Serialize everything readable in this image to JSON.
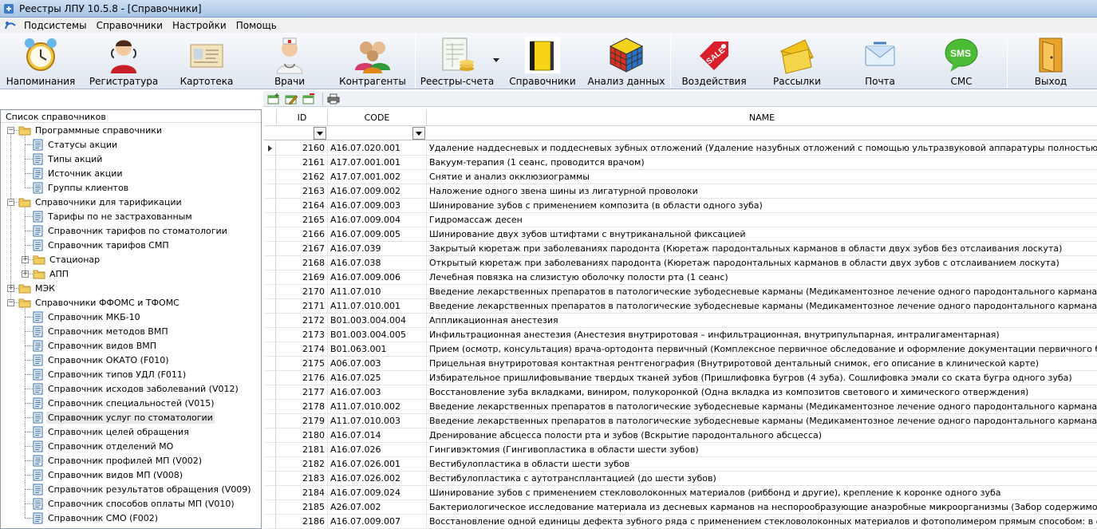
{
  "window": {
    "title": "Реестры ЛПУ 10.5.8 - [Справочники]"
  },
  "menu": [
    "Подсистемы",
    "Справочники",
    "Настройки",
    "Помощь"
  ],
  "toolbar": [
    {
      "label": "Напоминания",
      "icon": "alarm-clock-icon"
    },
    {
      "label": "Регистратура",
      "icon": "receptionist-icon"
    },
    {
      "label": "Картотека",
      "icon": "card-file-icon"
    },
    {
      "label": "Врачи",
      "icon": "doctor-icon"
    },
    {
      "label": "Контрагенты",
      "icon": "people-icon"
    },
    {
      "label": "Реестры-счета",
      "icon": "invoice-registry-icon"
    },
    {
      "label": "Справочники",
      "icon": "books-icon"
    },
    {
      "label": "Анализ данных",
      "icon": "rubik-cube-icon"
    },
    {
      "label": "Воздействия",
      "icon": "sale-tag-icon"
    },
    {
      "label": "Рассылки",
      "icon": "envelope-icon"
    },
    {
      "label": "Почта",
      "icon": "mail-icon"
    },
    {
      "label": "СМС",
      "icon": "sms-bubble-icon"
    },
    {
      "label": "Выход",
      "icon": "exit-door-icon"
    }
  ],
  "left_panel": {
    "title": "Список справочников",
    "tree": [
      {
        "label": "Программные справочники",
        "level": 0,
        "type": "folder",
        "expanded": true
      },
      {
        "label": "Статусы акции",
        "level": 1,
        "type": "doc"
      },
      {
        "label": "Типы акций",
        "level": 1,
        "type": "doc"
      },
      {
        "label": "Источник акции",
        "level": 1,
        "type": "doc"
      },
      {
        "label": "Группы клиентов",
        "level": 1,
        "type": "doc"
      },
      {
        "label": "Справочники для тарификации",
        "level": 0,
        "type": "folder",
        "expanded": true
      },
      {
        "label": "Тарифы по не застрахованным",
        "level": 1,
        "type": "doc"
      },
      {
        "label": "Справочник тарифов по стоматологии",
        "level": 1,
        "type": "doc"
      },
      {
        "label": "Справочник тарифов СМП",
        "level": 1,
        "type": "doc"
      },
      {
        "label": "Стационар",
        "level": 1,
        "type": "folder",
        "expanded": false
      },
      {
        "label": "АПП",
        "level": 1,
        "type": "folder",
        "expanded": false
      },
      {
        "label": "МЭК",
        "level": 0,
        "type": "folder",
        "expanded": false
      },
      {
        "label": "Справочники ФФОМС и ТФОМС",
        "level": 0,
        "type": "folder",
        "expanded": true
      },
      {
        "label": "Справочник МКБ-10",
        "level": 1,
        "type": "doc"
      },
      {
        "label": "Справочник методов ВМП",
        "level": 1,
        "type": "doc"
      },
      {
        "label": "Справочник видов ВМП",
        "level": 1,
        "type": "doc"
      },
      {
        "label": "Справочник ОКАТО (F010)",
        "level": 1,
        "type": "doc"
      },
      {
        "label": "Справочник типов УДЛ (F011)",
        "level": 1,
        "type": "doc"
      },
      {
        "label": "Справочник исходов заболеваний (V012)",
        "level": 1,
        "type": "doc"
      },
      {
        "label": "Справочник специальностей (V015)",
        "level": 1,
        "type": "doc"
      },
      {
        "label": "Справочник услуг по стоматологии",
        "level": 1,
        "type": "doc",
        "selected": true
      },
      {
        "label": "Справочник целей обращения",
        "level": 1,
        "type": "doc"
      },
      {
        "label": "Справочник отделений МО",
        "level": 1,
        "type": "doc"
      },
      {
        "label": "Справочник профилей МП (V002)",
        "level": 1,
        "type": "doc"
      },
      {
        "label": "Справочник видов МП (V008)",
        "level": 1,
        "type": "doc"
      },
      {
        "label": "Справочник результатов обращения (V009)",
        "level": 1,
        "type": "doc"
      },
      {
        "label": "Справочник способов оплаты МП (V010)",
        "level": 1,
        "type": "doc"
      },
      {
        "label": "Справочник СМО (F002)",
        "level": 1,
        "type": "doc"
      }
    ]
  },
  "grid": {
    "columns": [
      "ID",
      "CODE",
      "NAME"
    ],
    "rows": [
      [
        "2160",
        "A16.07.020.001",
        "Удаление наддесневых и поддесневых зубных отложений (Удаление назубных отложений с помощью ультразвуковой аппаратуры полностью (не менее 5 зубов)"
      ],
      [
        "2161",
        "A17.07.001.001",
        "Вакуум-терапия (1 сеанс, проводится врачом)"
      ],
      [
        "2162",
        "A17.07.001.002",
        "Снятие и анализ окклюзиограммы"
      ],
      [
        "2163",
        "A16.07.009.002",
        "Наложение одного звена шины из лигатурной проволоки"
      ],
      [
        "2164",
        "A16.07.009.003",
        "Шинирование зубов с применением композита (в области одного зуба)"
      ],
      [
        "2165",
        "A16.07.009.004",
        "Гидромассаж десен"
      ],
      [
        "2166",
        "A16.07.009.005",
        "Шинирование двух зубов штифтами с внутриканальной фиксацией"
      ],
      [
        "2167",
        "A16.07.039",
        "Закрытый кюретаж при заболеваниях пародонта (Кюретаж пародонтальных карманов в области двух зубов без отслаивания лоскута)"
      ],
      [
        "2168",
        "A16.07.038",
        "Открытый кюретаж при заболеваниях пародонта (Кюретаж пародонтальных карманов в области двух зубов с отслаиванием лоскута)"
      ],
      [
        "2169",
        "A16.07.009.006",
        "Лечебная повязка на слизистую оболочку полости рта (1 сеанс)"
      ],
      [
        "2170",
        "A11.07.010",
        "Введение лекарственных препаратов в патологические зубодесневые карманы (Медикаментозное лечение одного пародонтального кармана: орошение)"
      ],
      [
        "2171",
        "A11.07.010.001",
        "Введение лекарственных препаратов в патологические зубодесневые карманы (Медикаментозное лечение одного пародонтального кармана: аппликация)"
      ],
      [
        "2172",
        "B01.003.004.004",
        "Аппликационная анестезия"
      ],
      [
        "2173",
        "B01.003.004.005",
        "Инфильтрационная анестезия (Анестезия внутриротовая – инфильтрационная, внутрипульпарная, интралигаментарная)"
      ],
      [
        "2174",
        "B01.063.001",
        "Прием (осмотр, консультация) врача-ортодонта первичный (Комплексное первичное обследование и оформление документации первичного больного (антропометр"
      ],
      [
        "2175",
        "A06.07.003",
        "Прицельная внутриротовая контактная рентгенография (Внутриротовой дентальный снимок, его описание в клинической карте)"
      ],
      [
        "2176",
        "A16.07.025",
        "Избирательное пришлифовывание твердых тканей зубов (Пришлифовка бугров (4 зуба). Сошлифовка эмали со ската бугра одного зуба)"
      ],
      [
        "2177",
        "A16.07.003",
        "Восстановление зуба вкладками, виниром, полукоронкой (Одна вкладка из композитов светового и химического отверждения)"
      ],
      [
        "2178",
        "A11.07.010.002",
        "Введение лекарственных препаратов в патологические зубодесневые карманы (Медикаментозное лечение одного пародонтального кармана: инстилляция)"
      ],
      [
        "2179",
        "A11.07.010.003",
        "Введение лекарственных препаратов в патологические зубодесневые карманы (Медикаментозное лечение одного пародонтального кармана: повязка)"
      ],
      [
        "2180",
        "A16.07.014",
        "Дренирование абсцесса полости рта и зубов (Вскрытие пародонтального абсцесса)"
      ],
      [
        "2181",
        "A16.07.026",
        "Гингивэктомия (Гингивопластика в области шести зубов)"
      ],
      [
        "2182",
        "A16.07.026.001",
        "Вестибулопластика в области шести зубов"
      ],
      [
        "2183",
        "A16.07.026.002",
        "Вестибулопластика с аутотрансплантацией (до шести зубов)"
      ],
      [
        "2184",
        "A16.07.009.024",
        "Шинирование зубов с применением стекловолоконных материалов (риббонд и другие), крепление к коронке одного зуба"
      ],
      [
        "2185",
        "A26.07.002",
        "Бактериологическое исследование материала из десневых карманов на неспорообразующие анаэробные микроорганизмы (Забор содержимого пародонтальных к"
      ],
      [
        "2186",
        "A16.07.009.007",
        "Восстановление одной единицы дефекта зубного ряда с применением стекловолоконных материалов и фотополимером прямым способом: в области фронтальных"
      ]
    ]
  }
}
